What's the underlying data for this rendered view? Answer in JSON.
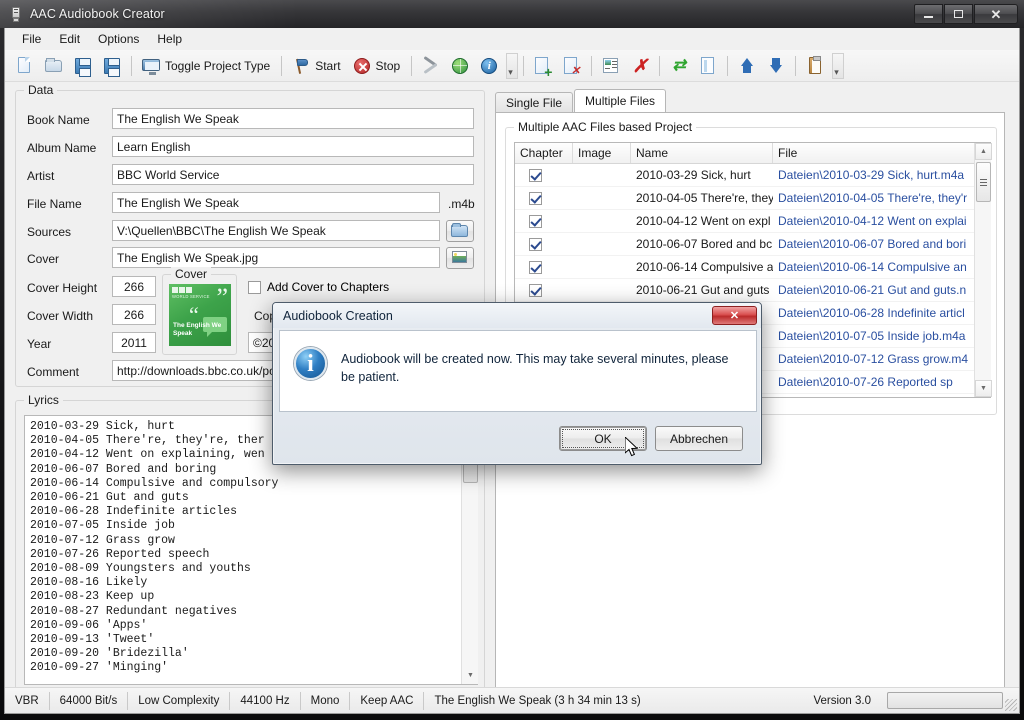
{
  "window": {
    "title": "AAC Audiobook Creator",
    "icon": "app-icon",
    "minimize_label": "Minimize",
    "maximize_label": "Maximize",
    "close_label": "Close"
  },
  "menu": [
    "File",
    "Edit",
    "Options",
    "Help"
  ],
  "toolbar": [
    {
      "name": "new-project",
      "icon": "new-page-icon",
      "label": ""
    },
    {
      "name": "open-project",
      "icon": "open-folder-icon",
      "label": ""
    },
    {
      "name": "save-project",
      "icon": "save-icon",
      "label": ""
    },
    {
      "name": "save-as-project",
      "icon": "save-as-icon",
      "label": ""
    },
    {
      "name": "toggle-project-type",
      "icon": "monitor-icon",
      "label": "Toggle Project Type"
    },
    {
      "name": "start",
      "icon": "start-flag-icon",
      "label": "Start"
    },
    {
      "name": "stop",
      "icon": "stop-icon",
      "label": "Stop"
    },
    {
      "name": "settings",
      "icon": "tools-icon",
      "label": ""
    },
    {
      "name": "web",
      "icon": "globe-icon",
      "label": ""
    },
    {
      "name": "about",
      "icon": "info-icon",
      "label": "i"
    },
    {
      "name": "add-file",
      "icon": "add-page-icon",
      "label": ""
    },
    {
      "name": "remove-file",
      "icon": "delete-page-icon",
      "label": ""
    },
    {
      "name": "list-images",
      "icon": "list-image-icon",
      "label": ""
    },
    {
      "name": "clear-list",
      "icon": "red-x-icon",
      "label": "✗"
    },
    {
      "name": "refresh",
      "icon": "refresh-icon",
      "label": "⇄"
    },
    {
      "name": "document",
      "icon": "document-icon",
      "label": ""
    },
    {
      "name": "move-up",
      "icon": "arrow-up-icon",
      "label": ""
    },
    {
      "name": "move-down",
      "icon": "arrow-down-icon",
      "label": ""
    },
    {
      "name": "clipboard",
      "icon": "clipboard-icon",
      "label": ""
    }
  ],
  "data_group": {
    "title": "Data",
    "fields": {
      "book_name_label": "Book Name",
      "book_name_value": "The English We Speak",
      "album_name_label": "Album Name",
      "album_name_value": "Learn English",
      "artist_label": "Artist",
      "artist_value": "BBC World Service",
      "file_name_label": "File Name",
      "file_name_value": "The English We Speak",
      "file_name_suffix": ".m4b",
      "sources_label": "Sources",
      "sources_value": "V:\\Quellen\\BBC\\The English We Speak",
      "cover_label": "Cover",
      "cover_value": "The English We Speak.jpg",
      "cover_height_label": "Cover Height",
      "cover_height_value": "266",
      "cover_width_label": "Cover Width",
      "cover_width_value": "266",
      "year_label": "Year",
      "year_value": "2011",
      "comment_label": "Comment",
      "comment_value": "http://downloads.bbc.co.uk/po",
      "add_cover_to_chapters_label": "Add Cover to Chapters",
      "add_cover_to_chapters_checked": false,
      "copyright_label": "Cop",
      "copyright_value": "©20"
    },
    "cover_preview": {
      "title": "Cover",
      "bbc_text": "WORLD SERVICE",
      "caption": "The English We Speak"
    }
  },
  "lyrics_group": {
    "title": "Lyrics",
    "text": "2010-03-29 Sick, hurt\n2010-04-05 There're, they're, ther\n2010-04-12 Went on explaining, wen\n2010-06-07 Bored and boring\n2010-06-14 Compulsive and compulsory\n2010-06-21 Gut and guts\n2010-06-28 Indefinite articles\n2010-07-05 Inside job\n2010-07-12 Grass grow\n2010-07-26 Reported speech\n2010-08-09 Youngsters and youths\n2010-08-16 Likely\n2010-08-23 Keep up\n2010-08-27 Redundant negatives\n2010-09-06 'Apps'\n2010-09-13 'Tweet'\n2010-09-20 'Bridezilla'\n2010-09-27 'Minging'"
  },
  "tabs": [
    {
      "label": "Single File",
      "active": false
    },
    {
      "label": "Multiple Files",
      "active": true
    }
  ],
  "project_group": {
    "title": "Multiple AAC Files based Project",
    "columns": [
      "Chapter",
      "Image",
      "Name",
      "File"
    ],
    "rows": [
      {
        "chapter": true,
        "image": "",
        "name": "2010-03-29 Sick, hurt",
        "file": "Dateien\\2010-03-29 Sick, hurt.m4a"
      },
      {
        "chapter": true,
        "image": "",
        "name": "2010-04-05 There're, they",
        "file": "Dateien\\2010-04-05 There're, they'r"
      },
      {
        "chapter": true,
        "image": "",
        "name": "2010-04-12 Went on expl",
        "file": "Dateien\\2010-04-12 Went on explai"
      },
      {
        "chapter": true,
        "image": "",
        "name": "2010-06-07 Bored and bc",
        "file": "Dateien\\2010-06-07 Bored and bori"
      },
      {
        "chapter": true,
        "image": "",
        "name": "2010-06-14 Compulsive a",
        "file": "Dateien\\2010-06-14 Compulsive an"
      },
      {
        "chapter": true,
        "image": "",
        "name": "2010-06-21 Gut and guts",
        "file": "Dateien\\2010-06-21 Gut and guts.n"
      },
      {
        "chapter": true,
        "image": "",
        "name": "",
        "file": "Dateien\\2010-06-28 Indefinite articl"
      },
      {
        "chapter": true,
        "image": "",
        "name": "",
        "file": "Dateien\\2010-07-05 Inside job.m4a"
      },
      {
        "chapter": true,
        "image": "",
        "name": "",
        "file": "Dateien\\2010-07-12 Grass grow.m4"
      },
      {
        "chapter": true,
        "image": "",
        "name": "",
        "file": "Dateien\\2010-07-26 Reported sp"
      }
    ]
  },
  "dialog": {
    "title": "Audiobook Creation",
    "icon": "info-icon",
    "icon_glyph": "i",
    "message": "Audiobook will be created now. This may take several minutes, please be patient.",
    "ok_label": "OK",
    "cancel_label": "Abbrechen",
    "close_label": "✕"
  },
  "statusbar": {
    "cells": [
      "VBR",
      "64000 Bit/s",
      "Low Complexity",
      "44100 Hz",
      "Mono",
      "Keep AAC",
      "The English We Speak  (3 h 34 min 13 s)"
    ],
    "version": "Version 3.0",
    "progress_percent": 0
  },
  "colors": {
    "accent_blue": "#2a4fa0",
    "title_bar": "#37373a",
    "close_red": "#bb2b2b",
    "cover_green": "#3da34a",
    "client_bg": "#f0f0f0"
  }
}
